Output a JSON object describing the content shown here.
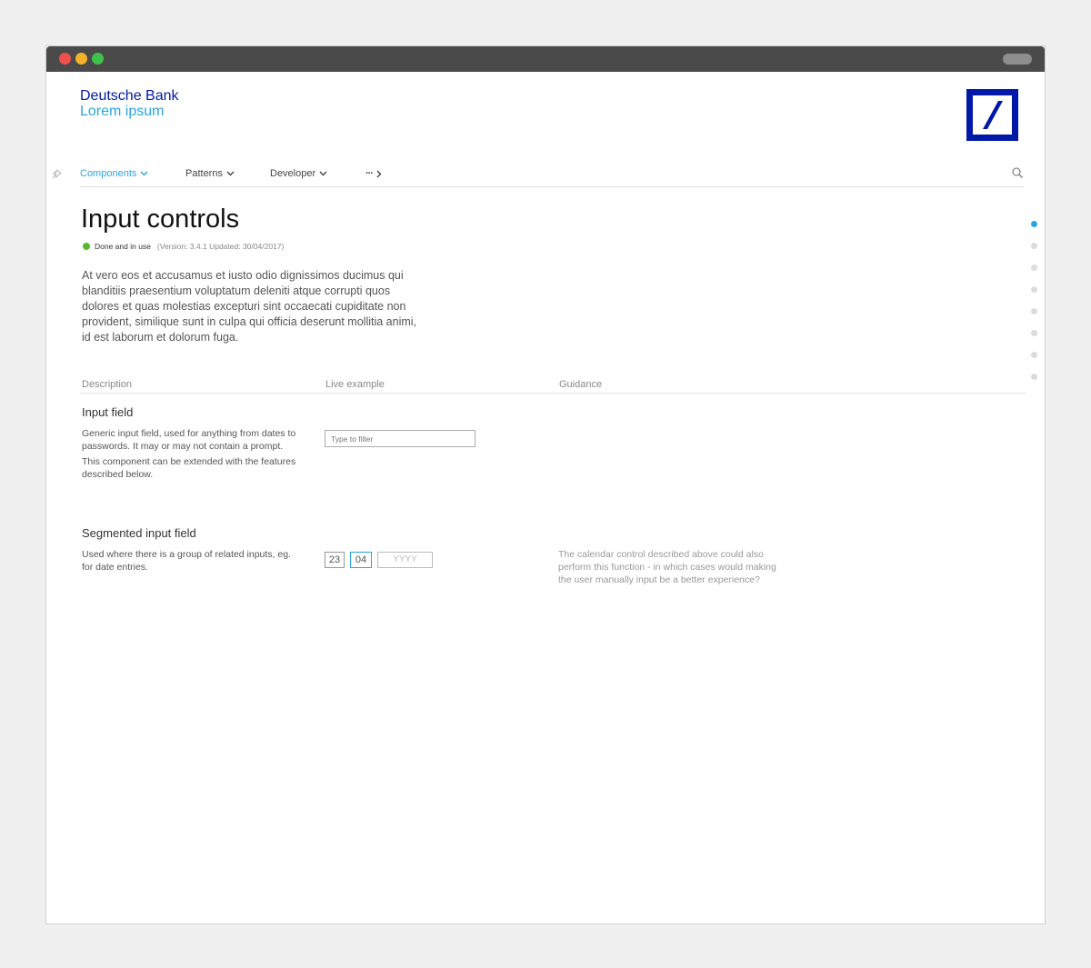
{
  "brand": {
    "name": "Deutsche Bank",
    "subtitle": "Lorem ipsum",
    "accent": "#0018a8",
    "highlight": "#29a5e0"
  },
  "nav": {
    "items": [
      {
        "label": "Components",
        "active": true,
        "icon": "chevron-down-icon"
      },
      {
        "label": "Patterns",
        "active": false,
        "icon": "chevron-down-icon"
      },
      {
        "label": "Developer",
        "active": false,
        "icon": "chevron-down-icon"
      },
      {
        "label": "···",
        "active": false,
        "icon": "chevron-right-icon"
      }
    ],
    "pin_icon": "pin-icon",
    "search_icon": "search-icon"
  },
  "page": {
    "title": "Input controls",
    "status": {
      "label": "Done and in use",
      "meta": "(Version: 3.4.1  Updated: 30/04/2017)",
      "color": "#5cb82b"
    },
    "intro": "At vero eos et accusamus et iusto odio dignissimos ducimus qui blanditiis praesentium voluptatum deleniti atque corrupti quos dolores et quas molestias excepturi sint occaecati cupiditate non provident, similique sunt in culpa qui officia deserunt mollitia animi, id est laborum et dolorum fuga."
  },
  "columns": {
    "description": "Description",
    "live_example": "Live example",
    "guidance": "Guidance"
  },
  "sections": {
    "input_field": {
      "title": "Input field",
      "text1": "Generic input field, used for anything from dates to passwords. It may or may not contain a prompt.",
      "text2": "This component can be extended with the features described below.",
      "placeholder": "Type to filter"
    },
    "segmented": {
      "title": "Segmented input field",
      "text": "Used where there is a group of related inputs, eg. for date entries.",
      "day": "23",
      "month": "04",
      "year_placeholder": "YYYY",
      "guidance": "The calendar control described above could also perform this function - in which cases would making the user manually input be a better experience?"
    }
  },
  "side_nav": {
    "count": 8,
    "active_index": 0
  }
}
